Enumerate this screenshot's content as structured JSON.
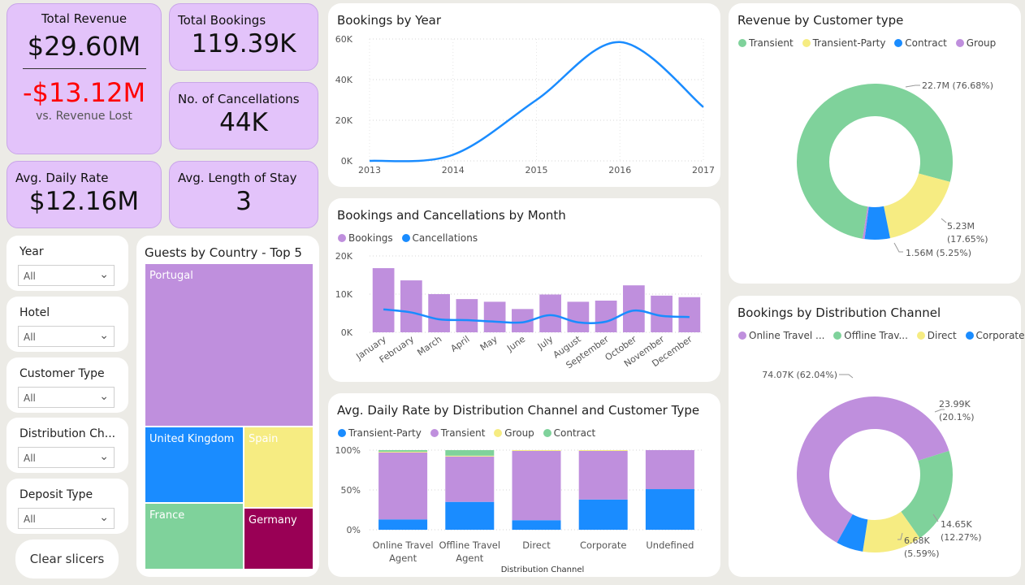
{
  "kpis": {
    "total_revenue": {
      "label": "Total Revenue",
      "value": "$29.60M",
      "lost_value": "-$13.12M",
      "lost_label": "vs. Revenue Lost"
    },
    "total_bookings": {
      "label": "Total Bookings",
      "value": "119.39K"
    },
    "cancellations": {
      "label": "No. of Cancellations",
      "value": "44K"
    },
    "avg_daily_rate": {
      "label": "Avg. Daily Rate",
      "value": "$12.16M"
    },
    "avg_stay": {
      "label": "Avg. Length of Stay",
      "value": "3"
    }
  },
  "slicers": [
    {
      "label": "Year",
      "value": "All"
    },
    {
      "label": "Hotel",
      "value": "All"
    },
    {
      "label": "Customer Type",
      "value": "All"
    },
    {
      "label": "Distribution Ch...",
      "value": "All"
    },
    {
      "label": "Deposit Type",
      "value": "All"
    }
  ],
  "clear_label": "Clear slicers",
  "colors": {
    "purple": "#bf8fdd",
    "blue": "#1a8cff",
    "yellow": "#f6ec82",
    "green": "#7fd29b",
    "magenta": "#990055",
    "kpi_bg": "#e3c3fa",
    "negative": "#ff0000"
  },
  "chart_data": [
    {
      "id": "bookings_by_year",
      "type": "line",
      "title": "Bookings by Year",
      "x": [
        "2013",
        "2014",
        "2015",
        "2016",
        "2017"
      ],
      "values": [
        0,
        3000,
        30000,
        58500,
        26500
      ],
      "yticks": [
        "0K",
        "20K",
        "40K",
        "60K"
      ],
      "ylim": [
        0,
        60000
      ]
    },
    {
      "id": "bookings_cancellations_month",
      "type": "bar",
      "title": "Bookings and Cancellations by Month",
      "categories": [
        "January",
        "February",
        "March",
        "April",
        "May",
        "June",
        "July",
        "August",
        "September",
        "October",
        "November",
        "December"
      ],
      "series": [
        {
          "name": "Bookings",
          "values": [
            16800,
            13600,
            10000,
            8700,
            8000,
            6100,
            9900,
            8000,
            8300,
            12300,
            9600,
            9200
          ]
        },
        {
          "name": "Cancellations",
          "values": [
            6000,
            5200,
            3400,
            3200,
            2800,
            2600,
            4500,
            2600,
            2800,
            5700,
            4300,
            4000
          ]
        }
      ],
      "yticks": [
        "0K",
        "10K",
        "20K"
      ],
      "ylim": [
        0,
        20000
      ]
    },
    {
      "id": "adr_channel_customer",
      "type": "bar",
      "title": "Avg. Daily Rate by Distribution Channel and Customer Type",
      "xlabel": "Distribution Channel",
      "categories": [
        "Online Travel Agent",
        "Offline Travel Agent",
        "Direct",
        "Corporate",
        "Undefined"
      ],
      "series": [
        {
          "name": "Transient-Party",
          "values": [
            13,
            35,
            12,
            38,
            51
          ]
        },
        {
          "name": "Transient",
          "values": [
            84,
            57,
            87,
            61,
            49
          ]
        },
        {
          "name": "Group",
          "values": [
            1,
            1,
            1,
            1,
            0
          ]
        },
        {
          "name": "Contract",
          "values": [
            2,
            7,
            0,
            0,
            0
          ]
        }
      ],
      "yticks": [
        "0%",
        "50%",
        "100%"
      ],
      "ylim": [
        0,
        100
      ]
    },
    {
      "id": "guests_by_country",
      "type": "treemap",
      "title": "Guests by Country - Top 5",
      "categories": [
        "Portugal",
        "United Kingdom",
        "Spain",
        "France",
        "Germany"
      ]
    },
    {
      "id": "revenue_customer_type",
      "type": "pie",
      "title": "Revenue by Customer type",
      "legend": [
        "Transient",
        "Transient-Party",
        "Contract",
        "Group"
      ],
      "slices": [
        {
          "name": "Transient",
          "value": 76.68,
          "label": "22.7M (76.68%)"
        },
        {
          "name": "Transient-Party",
          "value": 17.65,
          "label1": "5.23M",
          "label2": "(17.65%)"
        },
        {
          "name": "Contract",
          "value": 5.25,
          "label": "1.56M (5.25%)"
        },
        {
          "name": "Group",
          "value": 0.42,
          "label": ""
        }
      ]
    },
    {
      "id": "bookings_distribution_channel",
      "type": "pie",
      "title": "Bookings by Distribution Channel",
      "legend": [
        "Online Travel ...",
        "Offline Trav...",
        "Direct",
        "Corporate"
      ],
      "slices": [
        {
          "name": "Online Travel Agent",
          "value": 62.04,
          "label": "74.07K (62.04%)"
        },
        {
          "name": "Offline Travel Agent",
          "value": 20.1,
          "label1": "23.99K",
          "label2": "(20.1%)"
        },
        {
          "name": "Direct",
          "value": 12.27,
          "label1": "14.65K",
          "label2": "(12.27%)"
        },
        {
          "name": "Corporate",
          "value": 5.59,
          "label1": "6.68K",
          "label2": "(5.59%)"
        }
      ]
    }
  ]
}
